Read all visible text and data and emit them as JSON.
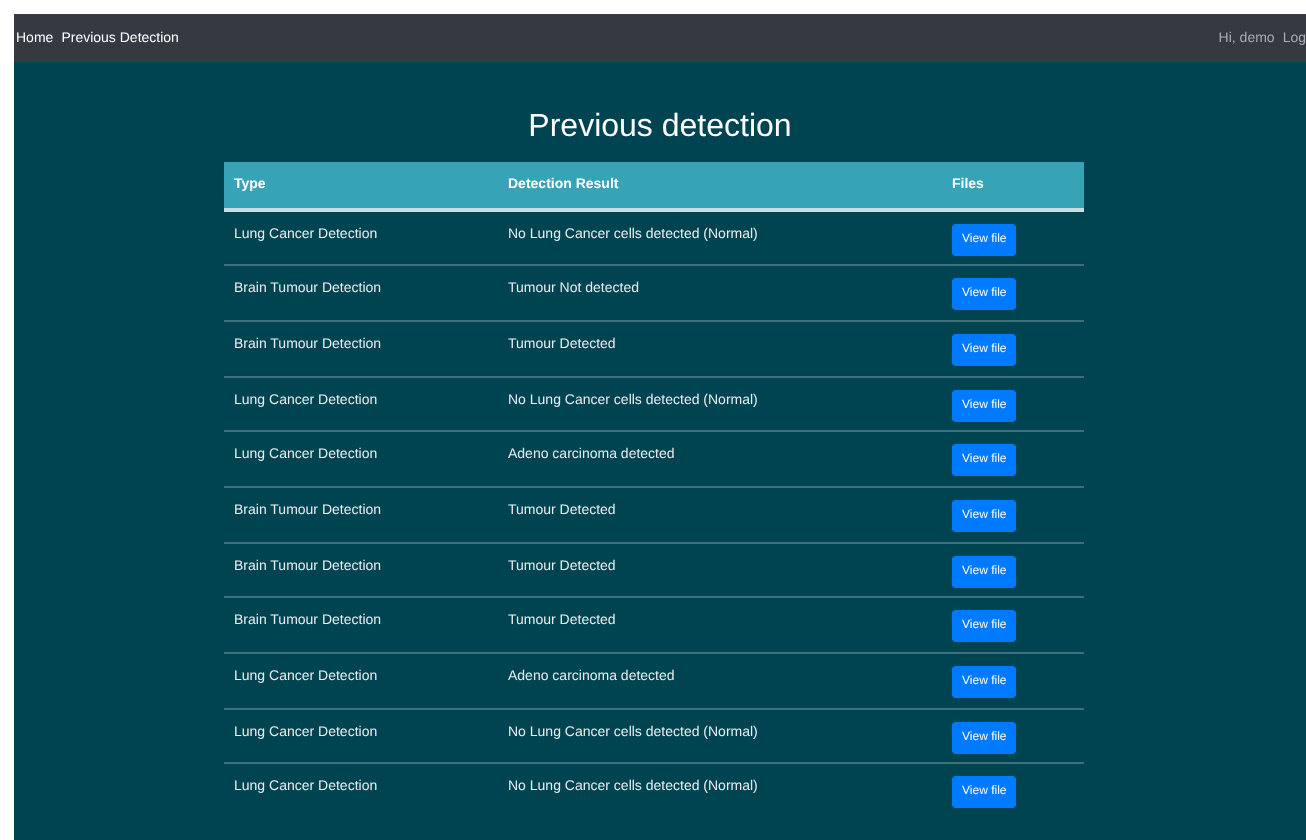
{
  "navbar": {
    "links": [
      "Home",
      "Previous Detection"
    ],
    "greeting": "Hi, demo",
    "logout": "Log"
  },
  "title": "Previous detection",
  "table": {
    "columns": [
      "Type",
      "Detection Result",
      "Files"
    ],
    "rows": [
      {
        "type": "Lung Cancer Detection",
        "result": "No Lung Cancer cells detected (Normal)",
        "file": "View file"
      },
      {
        "type": "Brain Tumour Detection",
        "result": "Tumour Not detected",
        "file": "View file"
      },
      {
        "type": "Brain Tumour Detection",
        "result": "Tumour Detected",
        "file": "View file"
      },
      {
        "type": "Lung Cancer Detection",
        "result": "No Lung Cancer cells detected (Normal)",
        "file": "View file"
      },
      {
        "type": "Lung Cancer Detection",
        "result": "Adeno carcinoma detected",
        "file": "View file"
      },
      {
        "type": "Brain Tumour Detection",
        "result": "Tumour Detected",
        "file": "View file"
      },
      {
        "type": "Brain Tumour Detection",
        "result": "Tumour Detected",
        "file": "View file"
      },
      {
        "type": "Brain Tumour Detection",
        "result": "Tumour Detected",
        "file": "View file"
      },
      {
        "type": "Lung Cancer Detection",
        "result": "Adeno carcinoma detected",
        "file": "View file"
      },
      {
        "type": "Lung Cancer Detection",
        "result": "No Lung Cancer cells detected (Normal)",
        "file": "View file"
      },
      {
        "type": "Lung Cancer Detection",
        "result": "No Lung Cancer cells detected (Normal)",
        "file": "View file"
      }
    ]
  }
}
